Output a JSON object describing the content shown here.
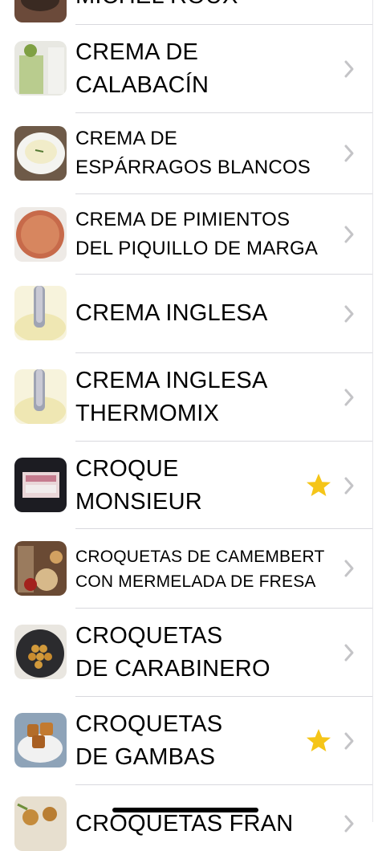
{
  "recipes": [
    {
      "line1": "MICHEL ROUX",
      "line2": "",
      "favorite": false,
      "thumb": "cake-icon"
    },
    {
      "line1": "CREMA DE",
      "line2": "CALABACÍN",
      "favorite": false,
      "thumb": "zucchini-cream-icon"
    },
    {
      "line1": "CREMA DE",
      "line2": "ESPÁRRAGOS BLANCOS",
      "favorite": false,
      "thumb": "asparagus-cream-icon"
    },
    {
      "line1": "CREMA DE PIMIENTOS",
      "line2": "DEL PIQUILLO DE MARGA",
      "favorite": false,
      "thumb": "pepper-cream-icon"
    },
    {
      "line1": "CREMA INGLESA",
      "line2": "",
      "favorite": false,
      "thumb": "custard-icon"
    },
    {
      "line1": "CREMA INGLESA",
      "line2": "THERMOMIX",
      "favorite": false,
      "thumb": "custard-icon"
    },
    {
      "line1": "CROQUE",
      "line2": "MONSIEUR",
      "favorite": true,
      "thumb": "sandwich-icon"
    },
    {
      "line1": "CROQUETAS DE CAMEMBERT",
      "line2": "CON MERMELADA DE FRESA",
      "favorite": false,
      "thumb": "croquettes-jam-icon"
    },
    {
      "line1": "CROQUETAS",
      "line2": "DE CARABINERO",
      "favorite": false,
      "thumb": "croquettes-plate-icon"
    },
    {
      "line1": "CROQUETAS",
      "line2": "DE GAMBAS",
      "favorite": false,
      "thumb": "croquettes-bowl-icon"
    },
    {
      "line1": "CROQUETAS FRAN",
      "line2": "",
      "favorite": false,
      "thumb": "croquettes-icon"
    }
  ],
  "colors": {
    "star": "#f5c518",
    "chevron": "#c4c4c7",
    "divider": "#d9d9de"
  }
}
